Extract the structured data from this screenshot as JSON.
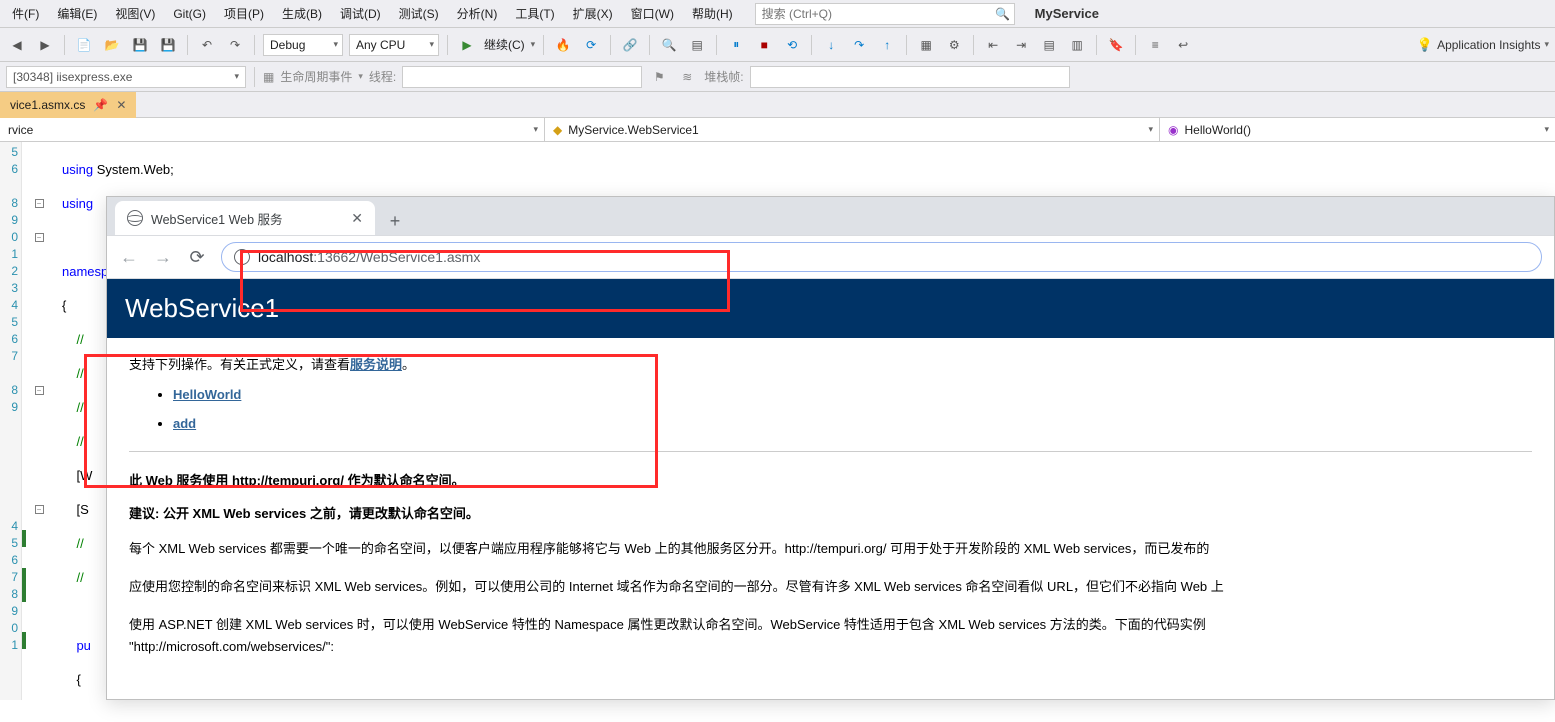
{
  "menu": {
    "items": [
      "件(F)",
      "编辑(E)",
      "视图(V)",
      "Git(G)",
      "项目(P)",
      "生成(B)",
      "调试(D)",
      "测试(S)",
      "分析(N)",
      "工具(T)",
      "扩展(X)",
      "窗口(W)",
      "帮助(H)"
    ],
    "search_placeholder": "搜索 (Ctrl+Q)",
    "solution": "MyService"
  },
  "toolbar": {
    "config": "Debug",
    "platform": "Any CPU",
    "run": "继续(C)",
    "app_insights": "Application Insights"
  },
  "debug_row": {
    "process": "[30348] iisexpress.exe",
    "lifecycle": "生命周期事件",
    "thread": "线程:",
    "stackframe": "堆栈帧:"
  },
  "doc_tab": {
    "filename": "vice1.asmx.cs"
  },
  "nav": {
    "ns": "rvice",
    "cls": "MyService.WebService1",
    "mth": "HelloWorld()"
  },
  "code": {
    "l1": "using System.Web;",
    "l2": "using",
    "l4": "namesp",
    "l5": "{",
    "l6_comment": "//",
    "l7_comment1": "//",
    "l7_comment2": "//",
    "l8_comment": "//",
    "l9_attr": "[W",
    "l10_attr": "[S",
    "l11_comment": "//",
    "l12_comment": "//",
    "l13_pu": "pu",
    "l14_brace": "{",
    "l22_close": "}"
  },
  "browser": {
    "tab_title": "WebService1 Web 服务",
    "url_host": "localhost",
    "url_path": ":13662/WebService1.asmx"
  },
  "ws": {
    "title": "WebService1",
    "intro_pre": "支持下列操作。有关正式定义，请查看",
    "intro_link": "服务说明",
    "intro_post": "。",
    "ops": [
      "HelloWorld",
      "add"
    ],
    "warn1": "此 Web 服务使用 http://tempuri.org/ 作为默认命名空间。",
    "warn2": "建议: 公开 XML Web services 之前，请更改默认命名空间。",
    "para1": "每个 XML Web services 都需要一个唯一的命名空间，以便客户端应用程序能够将它与 Web 上的其他服务区分开。http://tempuri.org/ 可用于处于开发阶段的 XML Web services，而已发布的",
    "para2": "应使用您控制的命名空间来标识 XML Web services。例如，可以使用公司的 Internet 域名作为命名空间的一部分。尽管有许多 XML Web services 命名空间看似 URL，但它们不必指向 Web 上",
    "para3": "使用 ASP.NET 创建 XML Web services 时，可以使用 WebService 特性的 Namespace 属性更改默认命名空间。WebService 特性适用于包含 XML Web services 方法的类。下面的代码实例",
    "para3b": "\"http://microsoft.com/webservices/\":"
  }
}
